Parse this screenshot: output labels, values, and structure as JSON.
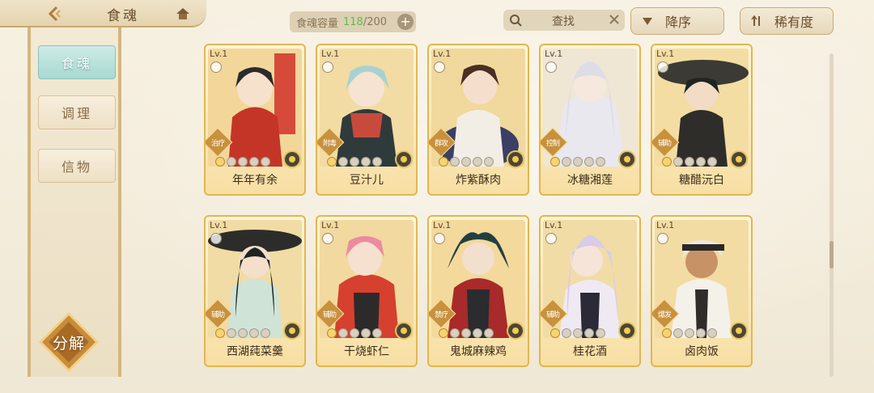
{
  "header": {
    "title": "食魂",
    "capacity_label": "食魂容量",
    "capacity_current": "118",
    "capacity_max": "/200",
    "search_label": "查找",
    "sort_order_label": "降序",
    "sort_rarity_label": "稀有度"
  },
  "sidebar": {
    "items": [
      {
        "label": "食魂",
        "active": true
      },
      {
        "label": "调理",
        "active": false
      },
      {
        "label": "信物",
        "active": false
      }
    ],
    "decompose_label": "分解"
  },
  "cards": [
    {
      "level": "Lv.1",
      "name": "年年有余",
      "role": "治疗"
    },
    {
      "level": "Lv.1",
      "name": "豆汁儿",
      "role": "附毒"
    },
    {
      "level": "Lv.1",
      "name": "炸紫酥肉",
      "role": "群攻"
    },
    {
      "level": "Lv.1",
      "name": "冰糖湘莲",
      "role": "控制"
    },
    {
      "level": "Lv.1",
      "name": "糖醋沅白",
      "role": "辅助"
    },
    {
      "level": "Lv.1",
      "name": "西湖莼菜羹",
      "role": "辅助"
    },
    {
      "level": "Lv.1",
      "name": "干烧虾仁",
      "role": "辅助"
    },
    {
      "level": "Lv.1",
      "name": "鬼城麻辣鸡",
      "role": "禁疗"
    },
    {
      "level": "Lv.1",
      "name": "桂花酒",
      "role": "辅助"
    },
    {
      "level": "Lv.1",
      "name": "卤肉饭",
      "role": "爆发"
    }
  ],
  "icons": {
    "back": "back-arrow-icon",
    "home": "home-icon",
    "search": "search-icon",
    "clear": "close-icon",
    "sort": "sort-down-icon",
    "rarity": "rarity-icon"
  },
  "colors": {
    "accent": "#c9ab73",
    "card_border": "#e2b650",
    "active_tab": "#a9d9d2",
    "capacity_current": "#5fbd4b"
  }
}
